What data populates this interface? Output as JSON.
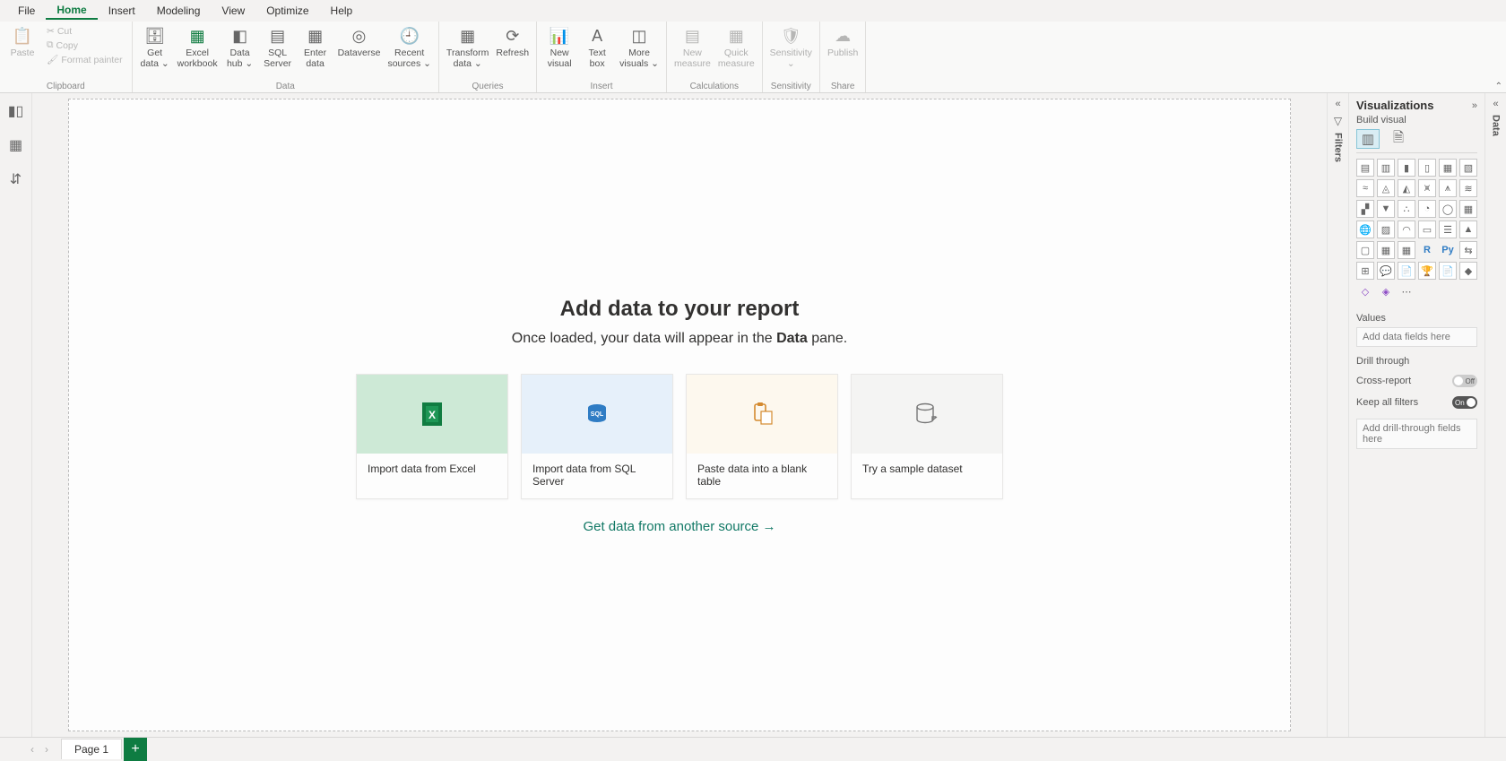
{
  "tabs": [
    "File",
    "Home",
    "Insert",
    "Modeling",
    "View",
    "Optimize",
    "Help"
  ],
  "activeTab": "Home",
  "ribbon": {
    "clipboard": {
      "paste": "Paste",
      "cut": "Cut",
      "copy": "Copy",
      "format_painter": "Format painter",
      "group": "Clipboard"
    },
    "data": {
      "get_data": "Get\ndata ⌄",
      "excel": "Excel\nworkbook",
      "data_hub": "Data\nhub ⌄",
      "sql": "SQL\nServer",
      "enter": "Enter\ndata",
      "dataverse": "Dataverse",
      "recent": "Recent\nsources ⌄",
      "group": "Data"
    },
    "queries": {
      "transform": "Transform\ndata ⌄",
      "refresh": "Refresh",
      "group": "Queries"
    },
    "insert": {
      "new_visual": "New\nvisual",
      "text_box": "Text\nbox",
      "more_visuals": "More\nvisuals ⌄",
      "group": "Insert"
    },
    "calc": {
      "new_measure": "New\nmeasure",
      "quick_measure": "Quick\nmeasure",
      "group": "Calculations"
    },
    "sens": {
      "sensitivity": "Sensitivity\n⌄",
      "group": "Sensitivity"
    },
    "share": {
      "publish": "Publish",
      "group": "Share"
    }
  },
  "canvas": {
    "title": "Add data to your report",
    "subtitle_prefix": "Once loaded, your data will appear in the ",
    "subtitle_bold": "Data",
    "subtitle_suffix": " pane.",
    "cards": {
      "excel": "Import data from Excel",
      "sql": "Import data from SQL Server",
      "paste": "Paste data into a blank table",
      "sample": "Try a sample dataset"
    },
    "another": "Get data from another source →"
  },
  "filtersLabel": "Filters",
  "vis": {
    "title": "Visualizations",
    "subtitle": "Build visual",
    "values": "Values",
    "values_drop": "Add data fields here",
    "drill": "Drill through",
    "cross_report": "Cross-report",
    "cross_report_state": "Off",
    "keep_filters": "Keep all filters",
    "keep_filters_state": "On",
    "drill_drop": "Add drill-through fields here"
  },
  "dataLabel": "Data",
  "pages": {
    "page1": "Page 1"
  }
}
